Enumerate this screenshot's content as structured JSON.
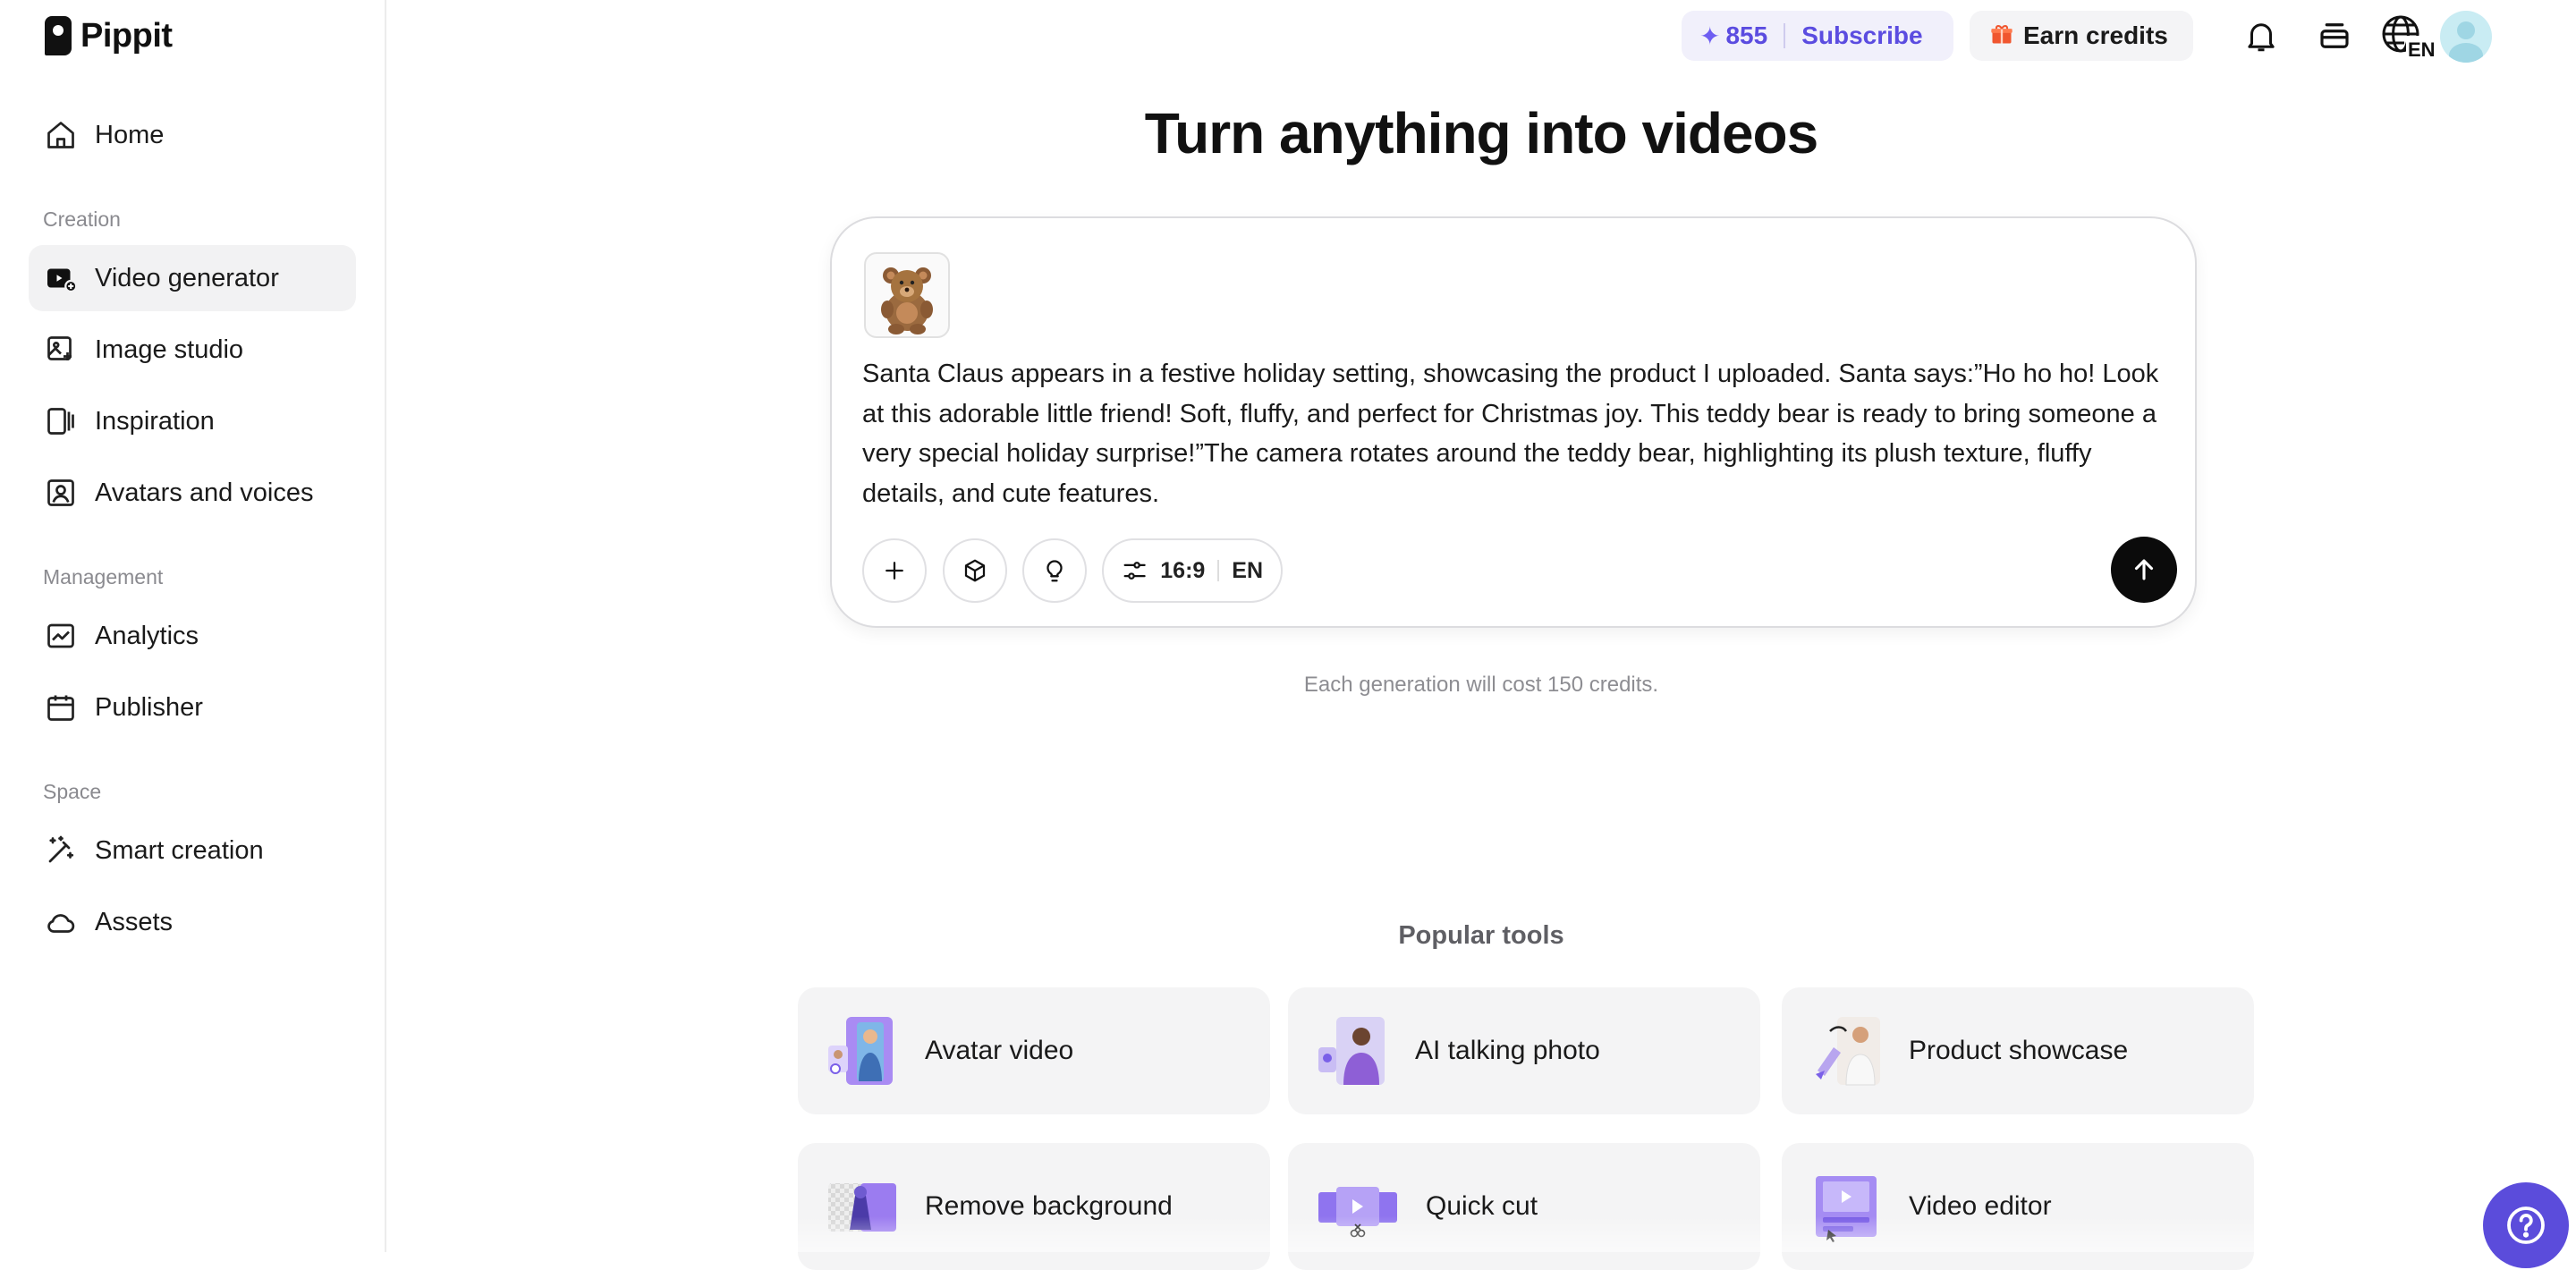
{
  "app": {
    "name": "Pippit"
  },
  "sidebar": {
    "home": "Home",
    "sections": {
      "creation": "Creation",
      "management": "Management",
      "space": "Space"
    },
    "items": [
      {
        "label": "Video generator",
        "icon": "video-plus-icon",
        "active": true
      },
      {
        "label": "Image studio",
        "icon": "image-edit-icon"
      },
      {
        "label": "Inspiration",
        "icon": "inspiration-icon"
      },
      {
        "label": "Avatars and voices",
        "icon": "avatar-voice-icon"
      },
      {
        "label": "Analytics",
        "icon": "chart-icon"
      },
      {
        "label": "Publisher",
        "icon": "calendar-icon"
      },
      {
        "label": "Smart creation",
        "icon": "magic-wand-icon"
      },
      {
        "label": "Assets",
        "icon": "cloud-icon"
      }
    ]
  },
  "header": {
    "credits": "855",
    "subscribe": "Subscribe",
    "earn_credits": "Earn credits",
    "language": "EN"
  },
  "main": {
    "title": "Turn anything into videos",
    "prompt": "Santa Claus appears in a festive holiday setting, showcasing the product I uploaded. Santa says:”Ho ho ho! Look at this adorable little friend! Soft, fluffy, and perfect for Christmas joy. This teddy bear is ready to bring someone a very special holiday surprise!”The camera rotates around the teddy bear, highlighting its plush texture, fluffy details, and cute features.",
    "aspect_ratio": "16:9",
    "language": "EN",
    "cost_note": "Each generation will cost 150 credits."
  },
  "popular": {
    "title": "Popular tools",
    "tools": [
      {
        "label": "Avatar video"
      },
      {
        "label": "AI talking photo"
      },
      {
        "label": "Product showcase"
      },
      {
        "label": "Remove background"
      },
      {
        "label": "Quick cut"
      },
      {
        "label": "Video editor"
      }
    ]
  },
  "colors": {
    "accent": "#5b4cdb",
    "credits_text": "#5b4ce0",
    "gift": "#f0562f"
  }
}
